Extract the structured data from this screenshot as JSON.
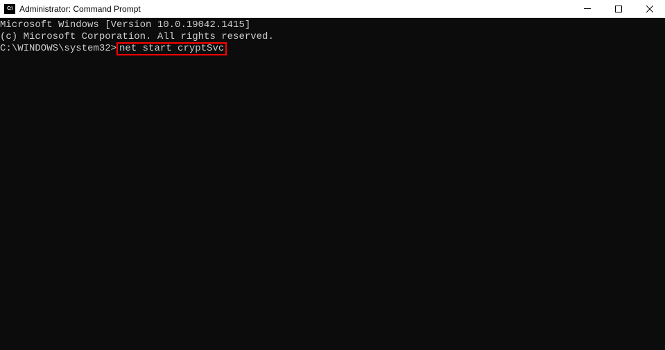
{
  "titlebar": {
    "icon_label": "C:\\",
    "title": "Administrator: Command Prompt"
  },
  "terminal": {
    "line1": "Microsoft Windows [Version 10.0.19042.1415]",
    "line2": "(c) Microsoft Corporation. All rights reserved.",
    "blank": "",
    "prompt": "C:\\WINDOWS\\system32>",
    "command": "net start cryptSvc"
  }
}
